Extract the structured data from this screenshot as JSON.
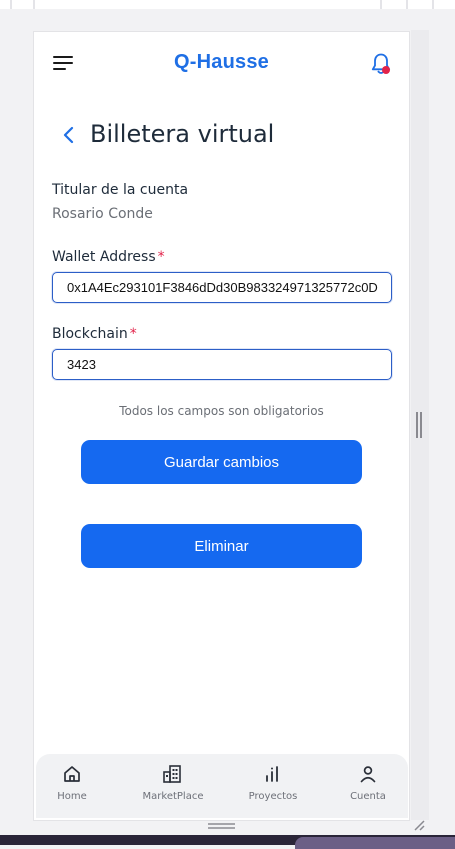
{
  "app": {
    "brand": "Q-Hausse"
  },
  "page": {
    "title": "Billetera virtual"
  },
  "account_holder": {
    "label": "Titular de la cuenta",
    "value": "Rosario Conde"
  },
  "wallet_address": {
    "label": "Wallet Address",
    "required_mark": "*",
    "value": "0x1A4Ec293101F3846dDd30B983324971325772c0D"
  },
  "blockchain": {
    "label": "Blockchain",
    "required_mark": "*",
    "value": "3423"
  },
  "form": {
    "hint": "Todos los campos son obligatorios",
    "save_label": "Guardar cambios",
    "delete_label": "Eliminar"
  },
  "nav": {
    "items": [
      {
        "label": "Home",
        "icon": "home-icon"
      },
      {
        "label": "MarketPlace",
        "icon": "buildings-icon"
      },
      {
        "label": "Proyectos",
        "icon": "bar-chart-icon"
      },
      {
        "label": "Cuenta",
        "icon": "user-icon"
      }
    ]
  },
  "colors": {
    "accent": "#1f6fe5",
    "button": "#1569f0",
    "required": "#e2234a",
    "notification_dot": "#e2234a"
  }
}
